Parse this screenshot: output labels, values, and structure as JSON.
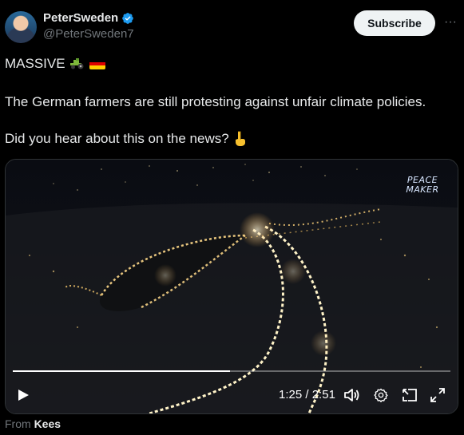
{
  "author": {
    "name": "PeterSweden",
    "handle": "@PeterSweden7"
  },
  "header": {
    "subscribe_label": "Subscribe",
    "more_label": "···"
  },
  "post": {
    "line1": "MASSIVE",
    "line2": "The German farmers are still protesting against unfair climate policies.",
    "line3": "Did you hear about this on the news?"
  },
  "video": {
    "watermark_line1": "PEACE",
    "watermark_line2": "MAKER",
    "current_time": "1:25",
    "separator": "/",
    "duration": "2:51",
    "progress": 0.497
  },
  "attribution": {
    "prefix": "From",
    "source": "Kees"
  },
  "colors": {
    "accent_verified": "#1d9bf0",
    "flag": [
      "#000000",
      "#dd0000",
      "#ffce00"
    ]
  },
  "icons": [
    "verified-badge-icon",
    "more-icon",
    "tractor-emoji",
    "german-flag-emoji",
    "pointing-down-emoji",
    "play-icon",
    "volume-icon",
    "settings-icon",
    "pip-icon",
    "fullscreen-icon"
  ]
}
